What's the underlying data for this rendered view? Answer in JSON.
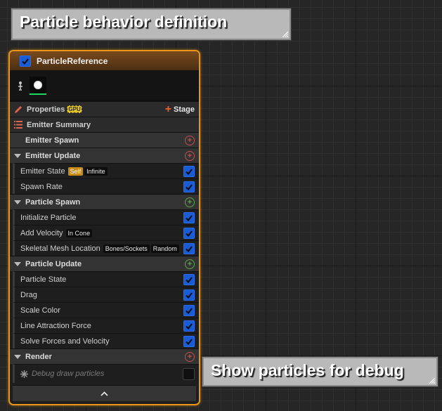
{
  "comments": {
    "top": "Particle behavior definition",
    "bottom": "Show particles for debug"
  },
  "node": {
    "title": "ParticleReference",
    "enabled": true,
    "properties_label": "Properties",
    "gpu_badge": "GPU",
    "stage_button": "Stage",
    "emitter_summary": "Emitter Summary",
    "emitter_spawn": "Emitter Spawn",
    "sections": {
      "emitter_update": "Emitter Update",
      "particle_spawn": "Particle Spawn",
      "particle_update": "Particle Update",
      "render": "Render"
    },
    "modules": {
      "emitter_state": "Emitter State",
      "emitter_state_tag1": "Self",
      "emitter_state_tag2": "Infinite",
      "spawn_rate": "Spawn Rate",
      "initialize_particle": "Initialize Particle",
      "add_velocity": "Add Velocity",
      "add_velocity_tag": "In Cone",
      "skeletal_mesh_location": "Skeletal Mesh Location",
      "skeletal_tag1": "Bones/Sockets",
      "skeletal_tag2": "Random",
      "particle_state": "Particle State",
      "drag": "Drag",
      "scale_color": "Scale Color",
      "line_attraction_force": "Line Attraction Force",
      "solve_forces": "Solve Forces and Velocity",
      "debug_draw": "Debug draw particles"
    },
    "debug_draw_enabled": false
  },
  "colors": {
    "selection_border": "#e8951b",
    "checkbox_on": "#1a5bd6",
    "stage_plus": "#e8612c",
    "thumb_underline": "#1ed760"
  }
}
